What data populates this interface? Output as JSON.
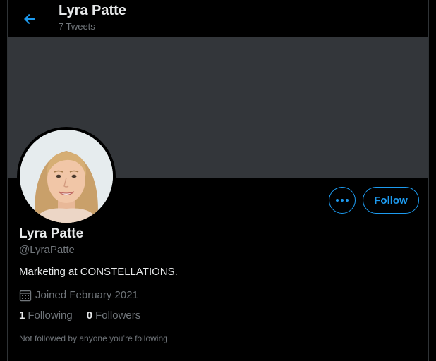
{
  "header": {
    "title": "Lyra Patte",
    "tweet_count": "7 Tweets"
  },
  "profile": {
    "display_name": "Lyra Patte",
    "handle": "@LyraPatte",
    "bio": "Marketing at CONSTELLATIONS.",
    "joined": "Joined February 2021",
    "following_count": "1",
    "following_label": "Following",
    "followers_count": "0",
    "followers_label": "Followers",
    "followed_by_note": "Not followed by anyone you’re following"
  },
  "actions": {
    "follow_label": "Follow"
  },
  "colors": {
    "accent": "#1d9bf0",
    "banner": "#33363a",
    "text_primary": "#e7e9ea",
    "text_secondary": "#71767b",
    "background": "#000000"
  },
  "icons": {
    "back": "arrow-left-icon",
    "more": "more-horizontal-icon",
    "calendar": "calendar-icon"
  }
}
